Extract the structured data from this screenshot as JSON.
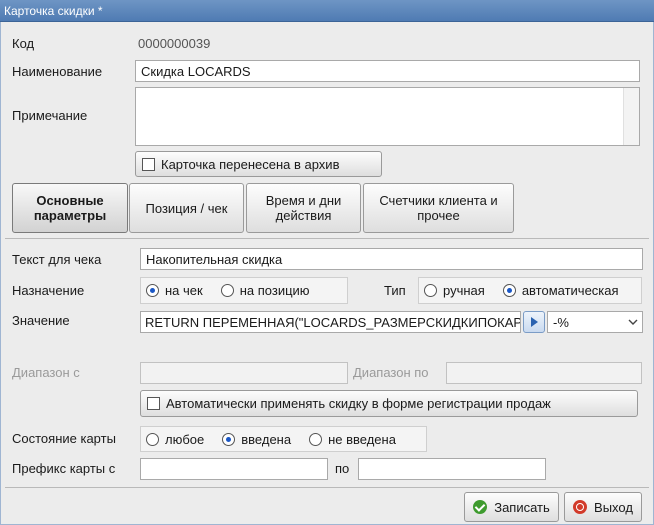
{
  "window": {
    "title": "Карточка скидки *"
  },
  "form": {
    "code_label": "Код",
    "code_value": "0000000039",
    "name_label": "Наименование",
    "name_value": "Скидка LOCARDS",
    "note_label": "Примечание",
    "note_value": "",
    "archive_label": "Карточка перенесена в архив",
    "archive_checked": false
  },
  "tabs": [
    {
      "label": "Основные\nпараметры",
      "active": true
    },
    {
      "label": "Позиция / чек",
      "active": false
    },
    {
      "label": "Время и дни\nдействия",
      "active": false
    },
    {
      "label": "Счетчики клиента и\nпрочее",
      "active": false
    }
  ],
  "params": {
    "receipt_text_label": "Текст для чека",
    "receipt_text_value": "Накопительная скидка",
    "purpose_label": "Назначение",
    "purpose_options": [
      "на чек",
      "на позицию"
    ],
    "purpose_selected": "на чек",
    "type_label": "Тип",
    "type_options": [
      "ручная",
      "автоматическая"
    ],
    "type_selected": "автоматическая",
    "value_label": "Значение",
    "value_expr": "RETURN ПЕРЕМЕННАЯ(\"LOCARDS_РАЗМЕРСКИДКИПОКАРТЕ\")",
    "value_unit": "-%",
    "range_from_label": "Диапазон с",
    "range_from_value": "",
    "range_to_label": "Диапазон по",
    "range_to_value": "",
    "auto_apply_label": "Автоматически применять скидку в форме регистрации продаж",
    "auto_apply_checked": false,
    "card_state_label": "Состояние карты",
    "card_state_options": [
      "любое",
      "введена",
      "не введена"
    ],
    "card_state_selected": "введена",
    "prefix_label": "Префикс карты с",
    "prefix_from_value": "",
    "prefix_to_label": "по",
    "prefix_to_value": ""
  },
  "footer": {
    "save_label": "Записать",
    "exit_label": "Выход"
  },
  "colors": {
    "accent": "#1a57c5",
    "title_bar": "#5a86bd",
    "save_icon": "#3e9b2e",
    "exit_icon": "#d23a2a"
  }
}
